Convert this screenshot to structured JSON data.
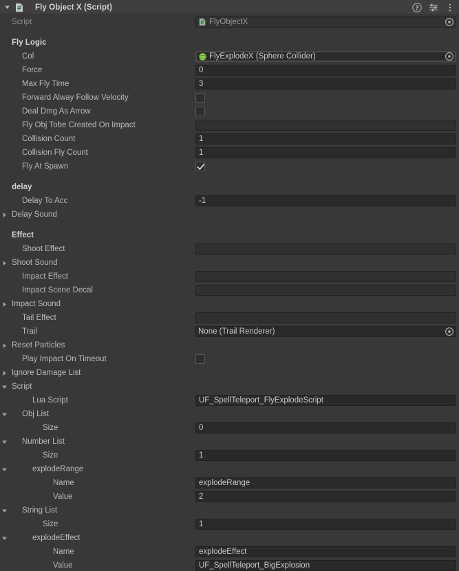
{
  "window": {
    "component_title": "Fly Object X (Script)",
    "script_icon": "csharp-script-icon",
    "foldout_state": "expanded",
    "header_icons": [
      "help-icon",
      "preset-icon",
      "more-menu-icon"
    ]
  },
  "colors": {
    "panel_bg": "#383838",
    "header_bg": "#3f3f3f",
    "field_bg": "#2a2a2a",
    "field_empty_bg": "#303030",
    "label": "#b9b9b9",
    "label_bold": "#d2d2d2",
    "label_dim": "#8a8a8a",
    "sphere_collider_green": "#8cd64a",
    "script_green": "#63b463"
  },
  "script_row": {
    "label": "Script",
    "value": "FlyObjectX",
    "icon": "csharp-script-icon",
    "picker": "object-picker-icon"
  },
  "sections": [
    {
      "header": "Fly Logic",
      "rows": [
        {
          "name": "col",
          "label": "Col",
          "indent": 1,
          "type": "objectref",
          "value": "FlyExplodeX (Sphere Collider)",
          "icon": "sphere-collider-icon",
          "focused": true,
          "picker": true
        },
        {
          "name": "force",
          "label": "Force",
          "indent": 1,
          "type": "number",
          "value": "0"
        },
        {
          "name": "max-fly-time",
          "label": "Max Fly Time",
          "indent": 1,
          "type": "number",
          "value": "3"
        },
        {
          "name": "forward-alway-follow-velocity",
          "label": "Forward Alway Follow Velocity",
          "indent": 1,
          "type": "checkbox",
          "checked": false
        },
        {
          "name": "deal-dmg-as-arrow",
          "label": "Deal Dmg As Arrow",
          "indent": 1,
          "type": "checkbox",
          "checked": false
        },
        {
          "name": "fly-obj-tobe-created-on-impact",
          "label": "Fly Obj Tobe Created On Impact",
          "indent": 1,
          "type": "objectref",
          "value": "",
          "empty": true
        },
        {
          "name": "collision-count",
          "label": "Collision Count",
          "indent": 1,
          "type": "number",
          "value": "1"
        },
        {
          "name": "collision-fly-count",
          "label": "Collision Fly Count",
          "indent": 1,
          "type": "number",
          "value": "1"
        },
        {
          "name": "fly-at-spawn",
          "label": "Fly At Spawn",
          "indent": 1,
          "type": "checkbox",
          "checked": true
        }
      ]
    },
    {
      "header": "delay",
      "rows": [
        {
          "name": "delay-to-acc",
          "label": "Delay To Acc",
          "indent": 1,
          "type": "number",
          "value": "-1"
        },
        {
          "name": "delay-sound",
          "label": "Delay Sound",
          "indent": 0,
          "type": "foldout",
          "expanded": false
        }
      ]
    },
    {
      "header": "Effect",
      "rows": [
        {
          "name": "shoot-effect",
          "label": "Shoot Effect",
          "indent": 1,
          "type": "objectref",
          "value": "",
          "empty": true
        },
        {
          "name": "shoot-sound",
          "label": "Shoot Sound",
          "indent": 0,
          "type": "foldout",
          "expanded": false
        },
        {
          "name": "impact-effect",
          "label": "Impact Effect",
          "indent": 1,
          "type": "objectref",
          "value": "",
          "empty": true
        },
        {
          "name": "impact-scene-decal",
          "label": "Impact Scene Decal",
          "indent": 1,
          "type": "objectref",
          "value": "",
          "empty": true
        },
        {
          "name": "impact-sound",
          "label": "Impact Sound",
          "indent": 0,
          "type": "foldout",
          "expanded": false
        },
        {
          "name": "tail-effect",
          "label": "Tail Effect",
          "indent": 1,
          "type": "objectref",
          "value": "",
          "empty": true
        },
        {
          "name": "trail",
          "label": "Trail",
          "indent": 1,
          "type": "objectref",
          "value": "None (Trail Renderer)",
          "picker": true
        },
        {
          "name": "reset-particles",
          "label": "Reset Particles",
          "indent": 0,
          "type": "foldout",
          "expanded": false
        },
        {
          "name": "play-impact-on-timeout",
          "label": "Play Impact On Timeout",
          "indent": 1,
          "type": "checkbox",
          "checked": false
        },
        {
          "name": "ignore-damage-list",
          "label": "Ignore Damage List",
          "indent": 0,
          "type": "foldout",
          "expanded": false
        },
        {
          "name": "script",
          "label": "Script",
          "indent": 0,
          "type": "foldout",
          "expanded": true
        },
        {
          "name": "lua-script",
          "label": "Lua Script",
          "indent": 2,
          "type": "text",
          "value": "UF_SpellTeleport_FlyExplodeScript"
        },
        {
          "name": "obj-list",
          "label": "Obj List",
          "indent": 1,
          "type": "foldout",
          "expanded": true
        },
        {
          "name": "obj-list-size",
          "label": "Size",
          "indent": 3,
          "type": "number",
          "value": "0"
        },
        {
          "name": "number-list",
          "label": "Number List",
          "indent": 1,
          "type": "foldout",
          "expanded": true
        },
        {
          "name": "number-list-size",
          "label": "Size",
          "indent": 3,
          "type": "number",
          "value": "1"
        },
        {
          "name": "explode-range",
          "label": "explodeRange",
          "indent": 2,
          "type": "foldout",
          "expanded": true
        },
        {
          "name": "explode-range-name",
          "label": "Name",
          "indent": 4,
          "type": "text",
          "value": "explodeRange"
        },
        {
          "name": "explode-range-value",
          "label": "Value",
          "indent": 4,
          "type": "number",
          "value": "2"
        },
        {
          "name": "string-list",
          "label": "String List",
          "indent": 1,
          "type": "foldout",
          "expanded": true
        },
        {
          "name": "string-list-size",
          "label": "Size",
          "indent": 3,
          "type": "number",
          "value": "1"
        },
        {
          "name": "explode-effect",
          "label": "explodeEffect",
          "indent": 2,
          "type": "foldout",
          "expanded": true
        },
        {
          "name": "explode-effect-name",
          "label": "Name",
          "indent": 4,
          "type": "text",
          "value": "explodeEffect"
        },
        {
          "name": "explode-effect-value",
          "label": "Value",
          "indent": 4,
          "type": "text",
          "value": "UF_SpellTeleport_BigExplosion"
        }
      ]
    }
  ]
}
